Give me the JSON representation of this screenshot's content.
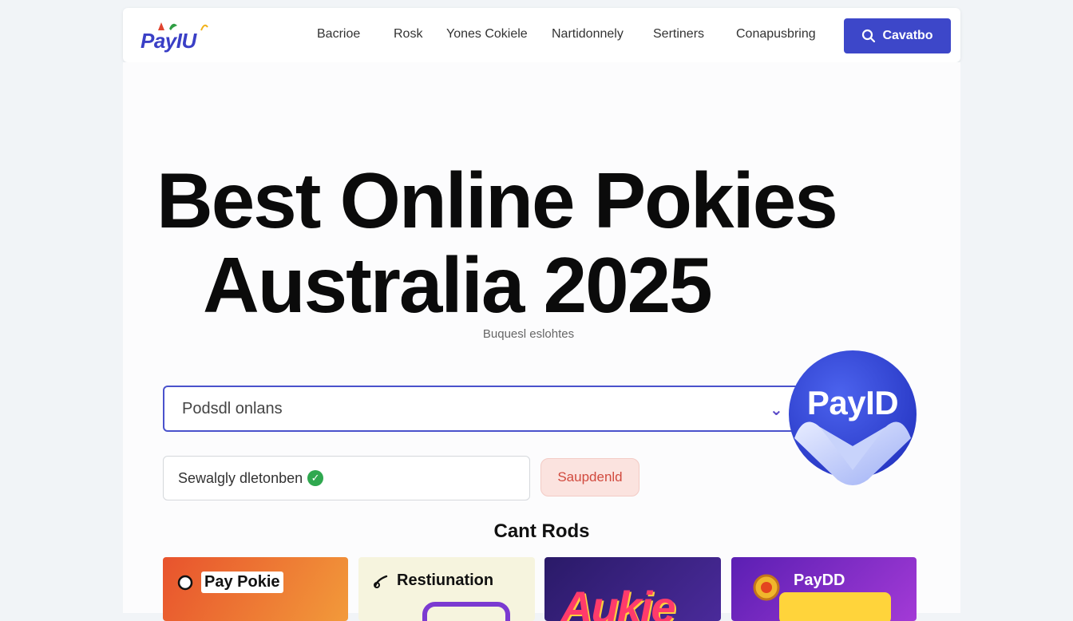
{
  "nav": {
    "logo_text": "PayIU",
    "links": [
      {
        "label": "Bacrioe"
      },
      {
        "label": "Rosk"
      },
      {
        "label": "Yones Cokiele"
      },
      {
        "label": "Nartidonnely"
      },
      {
        "label": "Sertiners"
      },
      {
        "label": "Conapusbring"
      }
    ],
    "cta_label": "Cavatbo"
  },
  "hero": {
    "line1": "Best Online Pokies",
    "line2": "Australia 2025",
    "subtitle": "Buquesl eslohtes"
  },
  "search": {
    "placeholder": "Podsdl onlans"
  },
  "badge": {
    "text": "PayID"
  },
  "filter": {
    "text": "Sewalgly dletonben",
    "pill_label": "Saupdenld"
  },
  "section": {
    "title": "Cant Rods"
  },
  "cards": [
    {
      "label": "Pay Pokie",
      "color": "#ee6a2a"
    },
    {
      "label": "Restiunation",
      "color": "#f6f3dc"
    },
    {
      "label": "Aukie",
      "color": "#3b1e7a"
    },
    {
      "label": "PayDD",
      "color": "#7b2fc4"
    }
  ],
  "colors": {
    "accent": "#3d47c9",
    "badge": "#2f46d6"
  }
}
